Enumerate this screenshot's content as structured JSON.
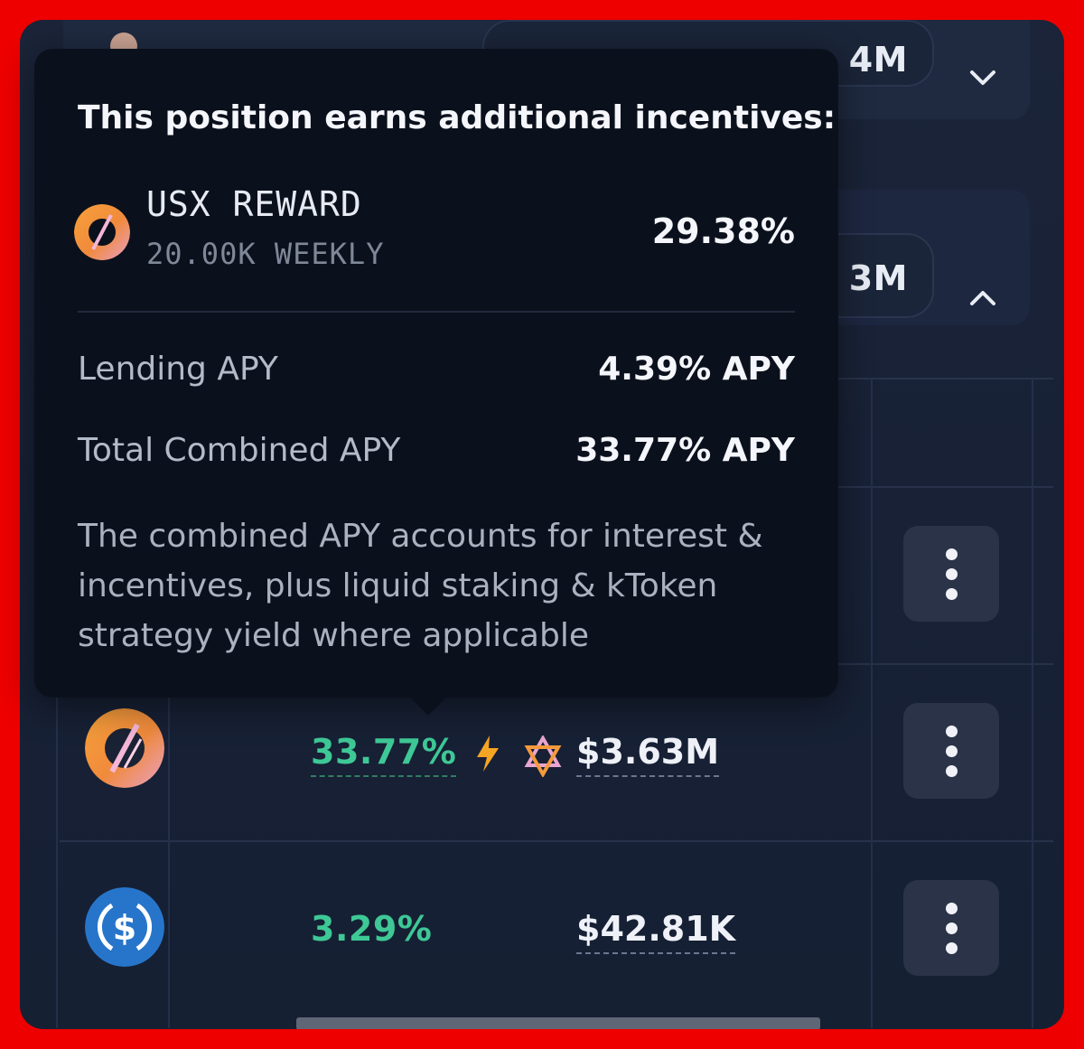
{
  "header_rows": [
    {
      "value_partial": " 4M",
      "chevron": "chevron-down-icon"
    },
    {
      "value_partial": " 3M",
      "chevron": "chevron-up-icon"
    }
  ],
  "tooltip": {
    "title": "This position earns additional incentives:",
    "reward": {
      "name": "USX REWARD",
      "weekly": "20.00K WEEKLY",
      "percent": "29.38%",
      "icon": "usx-token-icon"
    },
    "lending_label": "Lending APY",
    "lending_value": "4.39% APY",
    "total_label": "Total Combined APY",
    "total_value": "33.77% APY",
    "note": "The combined APY accounts for interest & incentives, plus liquid staking & kToken strategy yield where applicable"
  },
  "rows": [
    {
      "token_icon": "usx-token-icon",
      "apy": "33.77%",
      "boost_icon": "lightning-icon",
      "reward_icon": "star-of-david-icon",
      "supplied": "$3.63M",
      "menu_icon": "kebab-menu-icon"
    },
    {
      "token_icon": "usdc-token-icon",
      "apy": "3.29%",
      "supplied": "$42.81K",
      "menu_icon": "kebab-menu-icon"
    }
  ],
  "colors": {
    "apy_green": "#3ec896",
    "background": "#182136",
    "tooltip_bg": "#0b111c",
    "frame": "#ee0000"
  }
}
